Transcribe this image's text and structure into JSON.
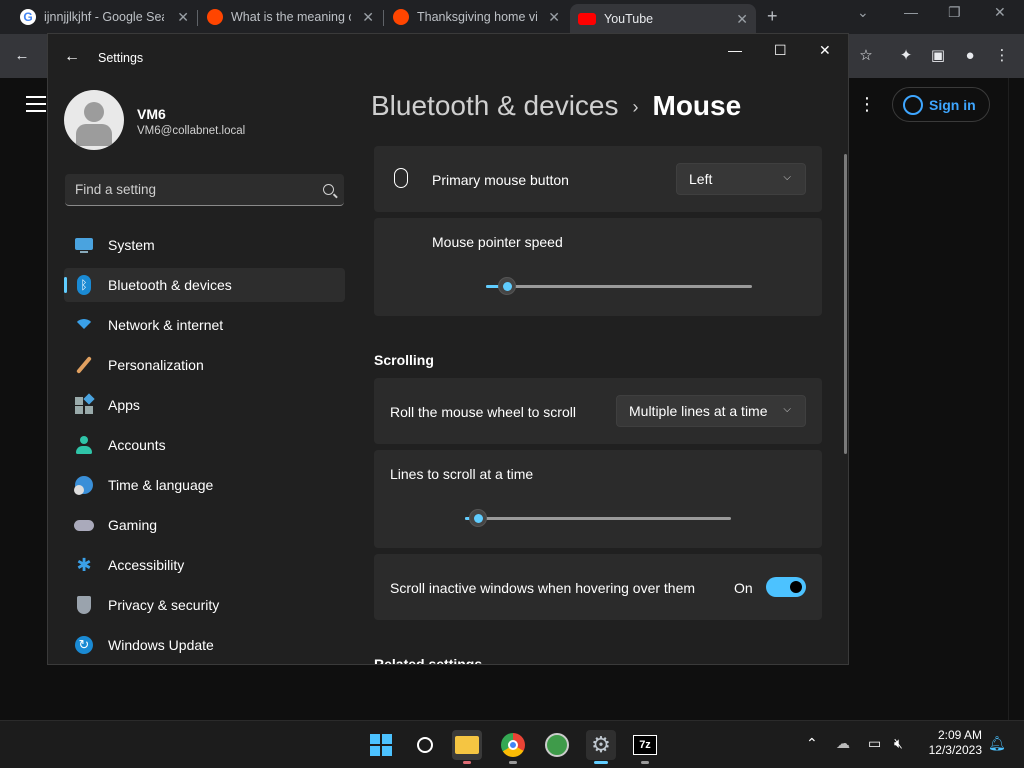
{
  "browser": {
    "tabs": [
      {
        "title": "ijnnjjlkjhf - Google Sea",
        "favicon_color": "#4285f4"
      },
      {
        "title": "What is the meaning of",
        "favicon_color": "#ff4500"
      },
      {
        "title": "Thanksgiving home vid",
        "favicon_color": "#ff4500"
      },
      {
        "title": "YouTube",
        "favicon_color": "#ff0000"
      }
    ],
    "new_tab_label": "+",
    "sign_in_label": "Sign in"
  },
  "settings": {
    "window_title": "Settings",
    "user": {
      "name": "VM6",
      "email": "VM6@collabnet.local"
    },
    "search_placeholder": "Find a setting",
    "nav": [
      {
        "label": "System",
        "icon": "monitor-icon"
      },
      {
        "label": "Bluetooth & devices",
        "icon": "bluetooth-icon"
      },
      {
        "label": "Network & internet",
        "icon": "wifi-icon"
      },
      {
        "label": "Personalization",
        "icon": "brush-icon"
      },
      {
        "label": "Apps",
        "icon": "apps-icon"
      },
      {
        "label": "Accounts",
        "icon": "person-icon"
      },
      {
        "label": "Time & language",
        "icon": "globe-clock-icon"
      },
      {
        "label": "Gaming",
        "icon": "gamepad-icon"
      },
      {
        "label": "Accessibility",
        "icon": "accessibility-icon"
      },
      {
        "label": "Privacy & security",
        "icon": "shield-icon"
      },
      {
        "label": "Windows Update",
        "icon": "update-icon"
      }
    ],
    "breadcrumb": {
      "parent": "Bluetooth & devices",
      "separator": "›",
      "current": "Mouse"
    },
    "primary_button": {
      "label": "Primary mouse button",
      "value": "Left"
    },
    "pointer_speed": {
      "label": "Mouse pointer speed",
      "value_fraction": 0.08
    },
    "scrolling_section": "Scrolling",
    "roll_wheel": {
      "label": "Roll the mouse wheel to scroll",
      "value": "Multiple lines at a time"
    },
    "lines_to_scroll": {
      "label": "Lines to scroll at a time",
      "value_fraction": 0.05
    },
    "scroll_inactive": {
      "label": "Scroll inactive windows when hovering over them",
      "state": "On"
    },
    "related_section": "Related settings"
  },
  "taskbar": {
    "time": "2:09 AM",
    "date": "12/3/2023"
  },
  "colors": {
    "accent": "#60cdff",
    "toggle_on": "#4cc2ff",
    "signin": "#3ea6ff"
  }
}
